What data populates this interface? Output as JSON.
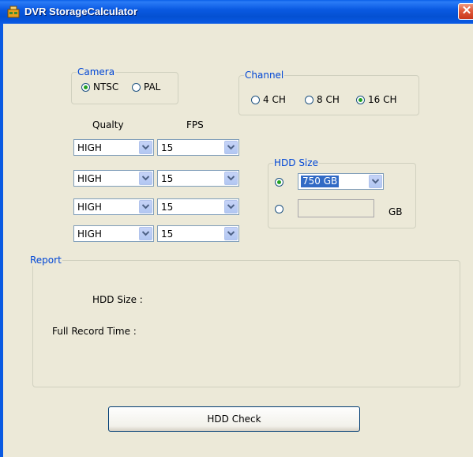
{
  "window": {
    "title": "DVR StorageCalculator",
    "close_glyph": "✕",
    "icon": "dvr-app-icon"
  },
  "camera": {
    "legend": "Camera",
    "options": [
      {
        "label": "NTSC",
        "selected": true
      },
      {
        "label": "PAL",
        "selected": false
      }
    ]
  },
  "channel": {
    "legend": "Channel",
    "options": [
      {
        "label": "4 CH",
        "selected": false
      },
      {
        "label": "8 CH",
        "selected": false
      },
      {
        "label": "16 CH",
        "selected": true
      }
    ]
  },
  "settings": {
    "quality_header": "Qualty",
    "fps_header": "FPS",
    "rows": [
      {
        "quality": "HIGH",
        "fps": "15"
      },
      {
        "quality": "HIGH",
        "fps": "15"
      },
      {
        "quality": "HIGH",
        "fps": "15"
      },
      {
        "quality": "HIGH",
        "fps": "15"
      }
    ]
  },
  "hdd_size": {
    "legend": "HDD Size",
    "preset_selected": true,
    "preset_value": "750 GB",
    "custom_selected": false,
    "custom_value": "",
    "unit": "GB"
  },
  "report": {
    "legend": "Report",
    "hdd_size_label": "HDD Size :",
    "full_record_time_label": "Full Record Time :"
  },
  "actions": {
    "hdd_check_label": "HDD Check"
  },
  "colors": {
    "legend_text": "#0046d5",
    "window_bg": "#ece9d8",
    "titlebar": "#0a5ae2",
    "radio_selected": "#21a121"
  }
}
